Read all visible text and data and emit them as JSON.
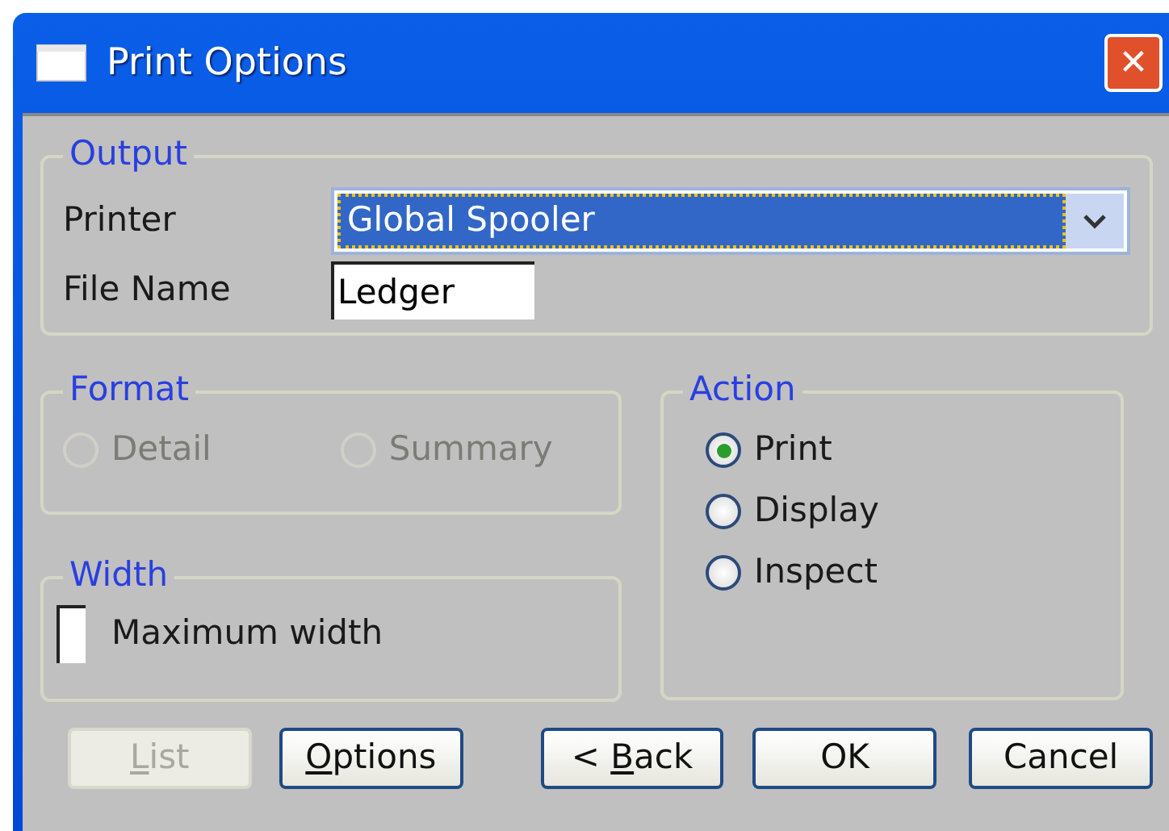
{
  "window": {
    "title": "Print Options",
    "close": "✕"
  },
  "output": {
    "legend": "Output",
    "printer_label": "Printer",
    "printer_value": "Global Spooler",
    "file_label": "File Name",
    "file_value": "Ledger"
  },
  "format": {
    "legend": "Format",
    "disabled": true,
    "options": [
      {
        "label": "Detail",
        "selected": false
      },
      {
        "label": "Summary",
        "selected": false
      }
    ]
  },
  "width": {
    "legend": "Width",
    "checkbox": {
      "label": "Maximum width",
      "checked": false
    }
  },
  "action": {
    "legend": "Action",
    "options": [
      {
        "label": "Print",
        "selected": true
      },
      {
        "label": "Display",
        "selected": false
      },
      {
        "label": "Inspect",
        "selected": false
      }
    ]
  },
  "buttons": [
    {
      "key": "L",
      "after": "ist",
      "disabled": true
    },
    {
      "key": "O",
      "after": "ptions",
      "disabled": false
    },
    {
      "before": "< ",
      "key": "B",
      "after": "ack",
      "disabled": false
    },
    {
      "before": "OK",
      "disabled": false
    },
    {
      "before": "Cancel",
      "disabled": false
    }
  ]
}
